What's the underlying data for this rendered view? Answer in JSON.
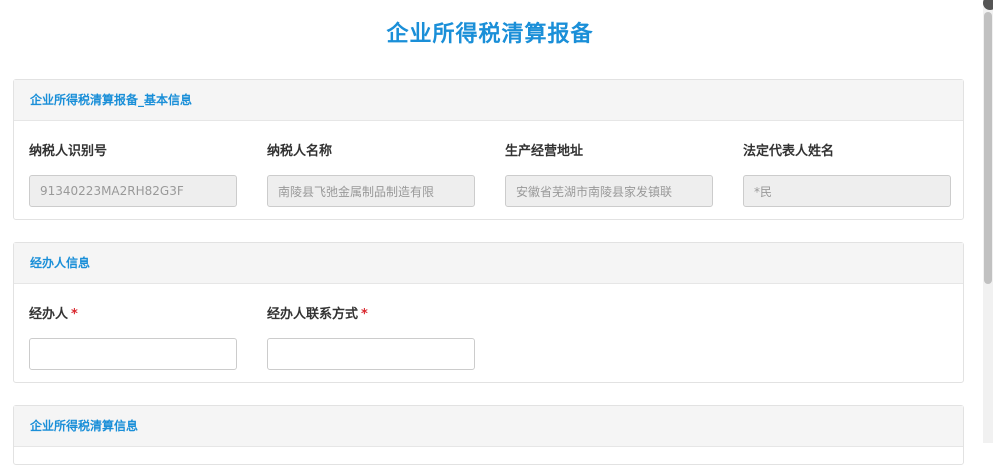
{
  "title": "企业所得税清算报备",
  "basic_info": {
    "header": "企业所得税清算报备_基本信息",
    "fields": [
      {
        "label": "纳税人识别号",
        "value": "91340223MA2RH82G3F"
      },
      {
        "label": "纳税人名称",
        "value": "南陵县飞弛金属制品制造有限"
      },
      {
        "label": "生产经营地址",
        "value": "安徽省芜湖市南陵县家发镇联"
      },
      {
        "label": "法定代表人姓名",
        "value": "*民"
      }
    ]
  },
  "agent_info": {
    "header": "经办人信息",
    "fields": [
      {
        "label": "经办人",
        "required_mark": "*",
        "value": ""
      },
      {
        "label": "经办人联系方式",
        "required_mark": "*",
        "value": ""
      }
    ]
  },
  "settlement_info": {
    "header": "企业所得税清算信息"
  },
  "colors": {
    "accent": "#1a8fd8",
    "required": "#d9272e",
    "readonly_bg": "#eeeeee"
  }
}
